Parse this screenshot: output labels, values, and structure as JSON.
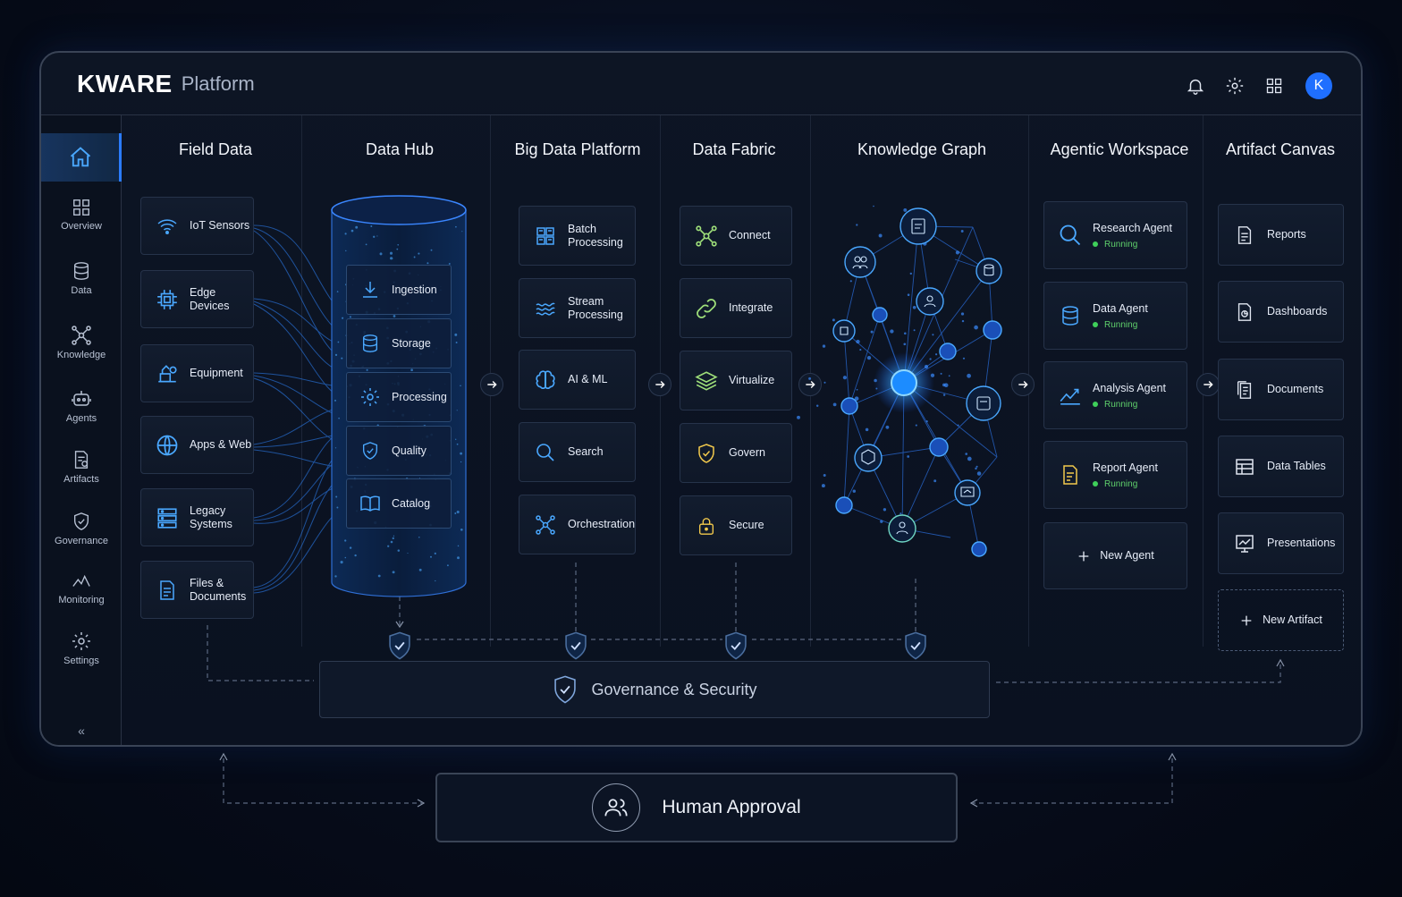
{
  "header": {
    "brand": "KWARE",
    "brand_sub": "Platform",
    "avatar_initial": "K",
    "icons": [
      "bell-icon",
      "gear-icon",
      "grid-icon"
    ]
  },
  "sidebar": {
    "items": [
      {
        "label": "Overview",
        "icon": "grid-icon"
      },
      {
        "label": "Data",
        "icon": "database-icon"
      },
      {
        "label": "Knowledge",
        "icon": "network-icon"
      },
      {
        "label": "Agents",
        "icon": "robot-icon"
      },
      {
        "label": "Artifacts",
        "icon": "artifact-icon"
      },
      {
        "label": "Governance",
        "icon": "shield-icon"
      },
      {
        "label": "Monitoring",
        "icon": "pulse-icon"
      },
      {
        "label": "Settings",
        "icon": "gear-icon"
      }
    ],
    "collapse": "«"
  },
  "columns": {
    "field": {
      "title": "Field Data",
      "items": [
        {
          "label": "IoT Sensors",
          "icon": "wifi-icon"
        },
        {
          "label": "Edge Devices",
          "icon": "chip-icon"
        },
        {
          "label": "Equipment",
          "icon": "equipment-icon"
        },
        {
          "label": "Apps & Web",
          "icon": "globe-icon"
        },
        {
          "label1": "Legacy",
          "label2": "Systems",
          "icon": "server-icon"
        },
        {
          "label1": "Files &",
          "label2": "Documents",
          "icon": "file-icon"
        }
      ]
    },
    "hub": {
      "title": "Data Hub",
      "items": [
        {
          "label": "Ingestion",
          "icon": "download-icon"
        },
        {
          "label": "Storage",
          "icon": "database-icon"
        },
        {
          "label": "Processing",
          "icon": "gear-icon"
        },
        {
          "label": "Quality",
          "icon": "shield-check-icon"
        },
        {
          "label": "Catalog",
          "icon": "book-icon"
        }
      ]
    },
    "bigdata": {
      "title": "Big Data Platform",
      "items": [
        {
          "label1": "Batch",
          "label2": "Processing",
          "icon": "batch-icon"
        },
        {
          "label1": "Stream",
          "label2": "Processing",
          "icon": "stream-icon"
        },
        {
          "label": "AI & ML",
          "icon": "brain-icon"
        },
        {
          "label": "Search",
          "icon": "search-icon"
        },
        {
          "label": "Orchestration",
          "icon": "orchestration-icon"
        }
      ]
    },
    "fabric": {
      "title": "Data Fabric",
      "items": [
        {
          "label": "Connect",
          "icon": "connect-icon"
        },
        {
          "label": "Integrate",
          "icon": "link-icon"
        },
        {
          "label": "Virtualize",
          "icon": "layers-icon"
        },
        {
          "label": "Govern",
          "icon": "shield-check-icon"
        },
        {
          "label": "Secure",
          "icon": "lock-icon"
        }
      ]
    },
    "graph": {
      "title": "Knowledge Graph"
    },
    "agents": {
      "title": "Agentic Workspace",
      "items": [
        {
          "label": "Research Agent",
          "status": "Running",
          "icon": "search-icon"
        },
        {
          "label": "Data Agent",
          "status": "Running",
          "icon": "database-icon"
        },
        {
          "label": "Analysis Agent",
          "status": "Running",
          "icon": "chart-icon"
        },
        {
          "label": "Report Agent",
          "status": "Running",
          "icon": "report-icon"
        }
      ],
      "new_label": "New Agent"
    },
    "artifacts": {
      "title": "Artifact Canvas",
      "items": [
        {
          "label": "Reports",
          "icon": "report-file-icon"
        },
        {
          "label": "Dashboards",
          "icon": "dashboard-file-icon"
        },
        {
          "label": "Documents",
          "icon": "documents-icon"
        },
        {
          "label": "Data Tables",
          "icon": "table-icon"
        },
        {
          "label": "Presentations",
          "icon": "presentation-icon"
        }
      ],
      "new_label": "New Artifact"
    }
  },
  "governance": {
    "label": "Governance & Security"
  },
  "human": {
    "label": "Human Approval"
  },
  "colors": {
    "accent": "#2b7cff",
    "running": "#3fd05a",
    "icon_blue": "#4aa8ff",
    "icon_green": "#9fe07a",
    "icon_yellow": "#f2c94c"
  }
}
